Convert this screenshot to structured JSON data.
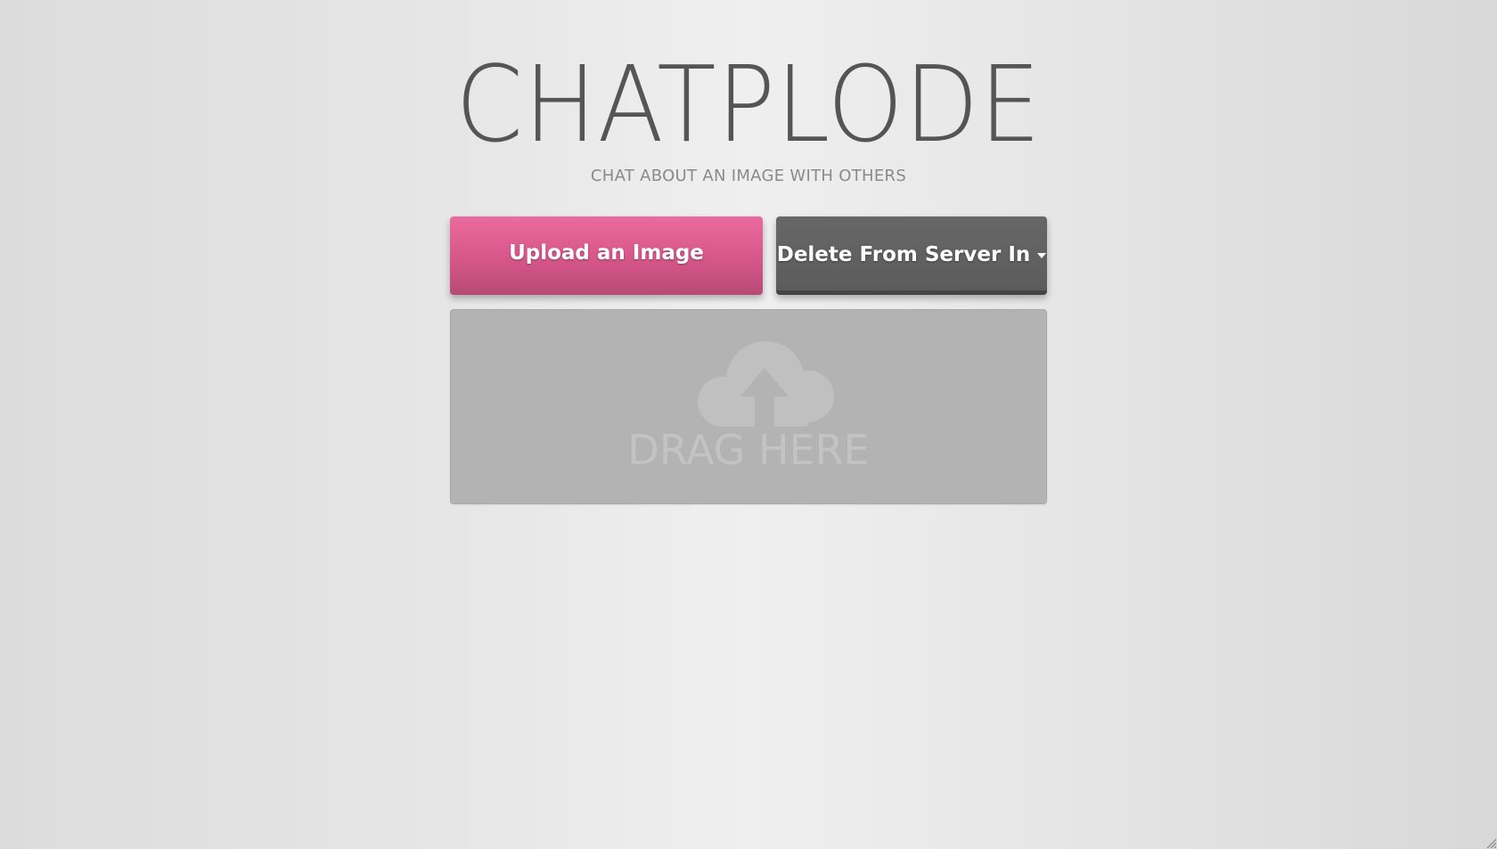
{
  "header": {
    "title": "CHATPLODE",
    "subtitle": "CHAT ABOUT AN IMAGE WITH OTHERS"
  },
  "actions": {
    "upload_label": "Upload an Image",
    "delete_label": "Delete From Server In"
  },
  "dropzone": {
    "icon": "cloud-upload-icon",
    "label": "DRAG HERE"
  },
  "colors": {
    "upload_button": "#d9588c",
    "delete_button": "#5c5c5c",
    "dropzone": "#b2b3b2",
    "title": "#555555"
  }
}
